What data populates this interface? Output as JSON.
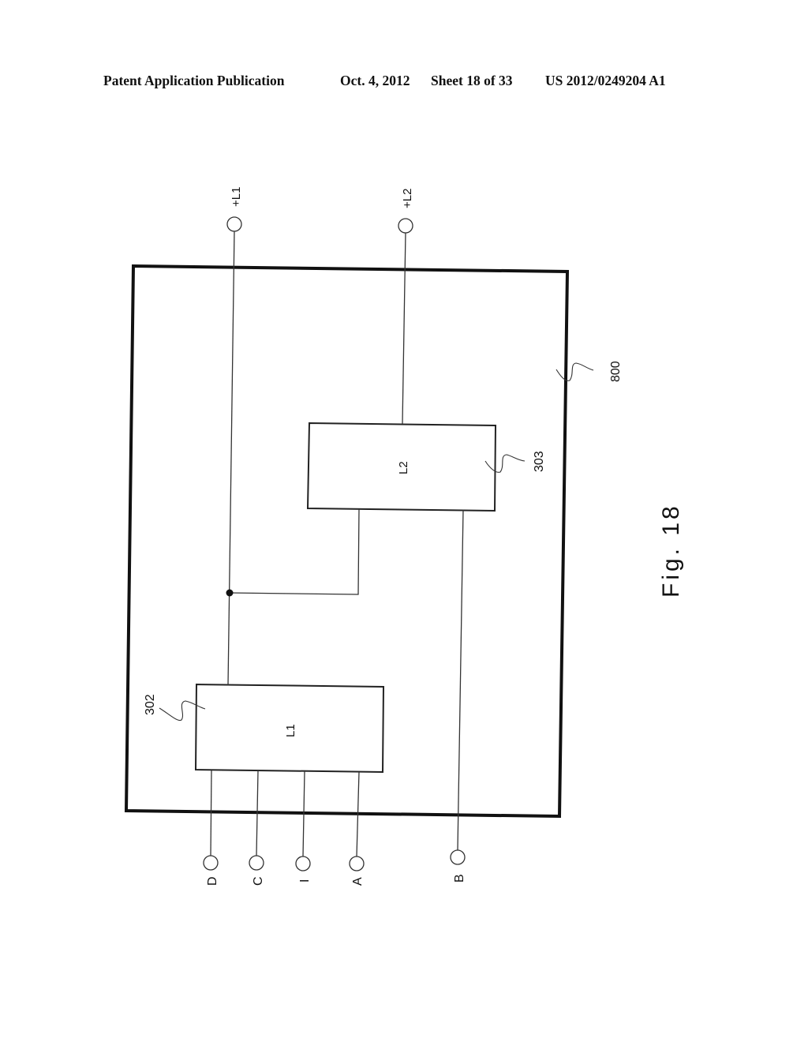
{
  "header": {
    "publication": "Patent Application Publication",
    "date": "Oct. 4, 2012",
    "sheet": "Sheet 18 of 33",
    "number": "US 2012/0249204 A1"
  },
  "figure": {
    "caption": "Fig. 18",
    "outer_ref": "800",
    "blocks": [
      {
        "id": "L1",
        "label": "L1",
        "ref": "302"
      },
      {
        "id": "L2",
        "label": "L2",
        "ref": "303"
      }
    ],
    "terminals": {
      "top": [
        "+L1",
        "+L2"
      ],
      "bottom": [
        "D",
        "C",
        "I",
        "A",
        "B"
      ]
    }
  }
}
